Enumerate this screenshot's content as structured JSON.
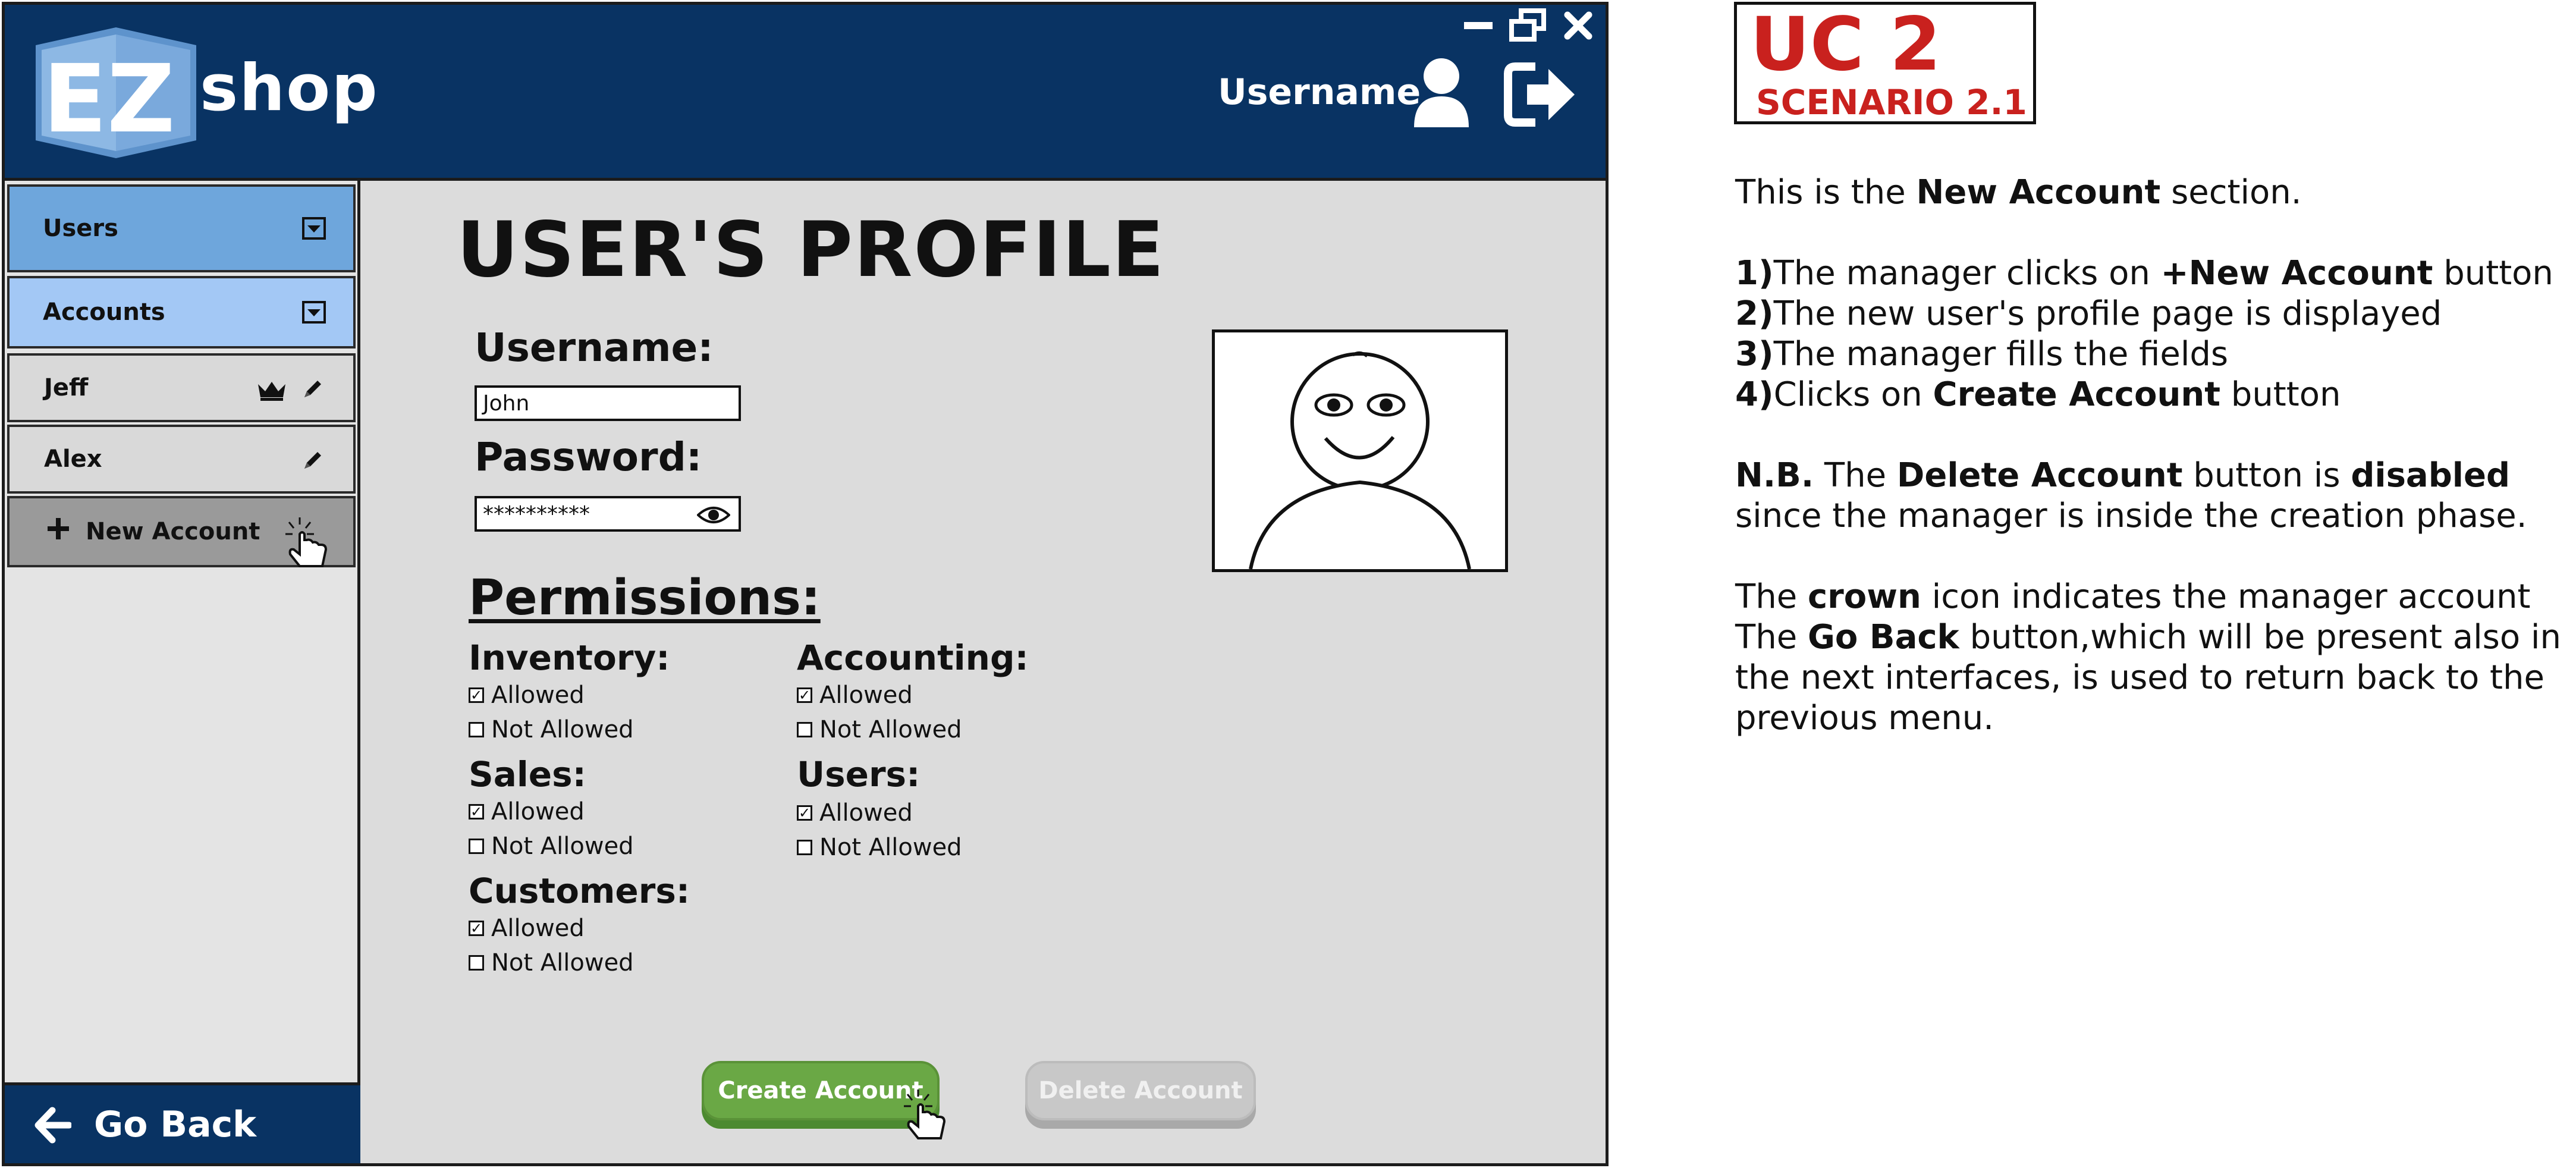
{
  "app": {
    "logo_letters": "EZ",
    "logo_text": "shop",
    "username_label": "Username"
  },
  "sidebar": {
    "users_label": "Users",
    "accounts_label": "Accounts",
    "accounts": [
      {
        "name": "Jeff",
        "is_manager": true
      },
      {
        "name": "Alex",
        "is_manager": false
      }
    ],
    "new_account_label": "New Account",
    "go_back_label": "Go Back"
  },
  "profile": {
    "title": "USER'S PROFILE",
    "username_label": "Username:",
    "username_value": "John",
    "password_label": "Password:",
    "password_value": "**********",
    "permissions_title": "Permissions:",
    "permissions": {
      "inventory": {
        "label": "Inventory:",
        "allowed": "Allowed",
        "not_allowed": "Not Allowed",
        "value": "Allowed"
      },
      "accounting": {
        "label": "Accounting:",
        "allowed": "Allowed",
        "not_allowed": "Not Allowed",
        "value": "Allowed"
      },
      "sales": {
        "label": "Sales:",
        "allowed": "Allowed",
        "not_allowed": "Not Allowed",
        "value": "Allowed"
      },
      "users": {
        "label": "Users:",
        "allowed": "Allowed",
        "not_allowed": "Not Allowed",
        "value": "Allowed"
      },
      "customers": {
        "label": "Customers:",
        "allowed": "Allowed",
        "not_allowed": "Not Allowed",
        "value": "Allowed"
      }
    },
    "create_button": "Create Account",
    "delete_button": "Delete Account"
  },
  "annotation": {
    "uc_title": "UC 2",
    "uc_scenario": "SCENARIO 2.1",
    "intro": [
      "This is the ",
      "New Account",
      " section."
    ],
    "steps": [
      {
        "num": "1)",
        "pre": "The manager clicks on ",
        "bold": "+New Account",
        "post": " button"
      },
      {
        "num": "2)",
        "pre": "The new user's profile page is displayed",
        "bold": "",
        "post": ""
      },
      {
        "num": "3)",
        "pre": "The manager fills the fields",
        "bold": "",
        "post": ""
      },
      {
        "num": "4)",
        "pre": "Clicks on ",
        "bold": "Create Account",
        "post": " button"
      }
    ],
    "nb": {
      "label": "N.B.",
      "t1": " The ",
      "b1": "Delete Account",
      "t2": " button is ",
      "b2": "disabled",
      "t3": " since the manager is inside the creation phase."
    },
    "crown_note": {
      "t1": "The ",
      "b1": "crown",
      "t2": " icon indicates the manager account"
    },
    "goback_note": {
      "t1": "The ",
      "b1": "Go Back",
      "t2": " button,which will be present also in the next interfaces, is used to return back to the previous menu."
    }
  },
  "colors": {
    "topbar": "#093363",
    "users_tab": "#6ea6dc",
    "accounts_tab": "#a3c8f5",
    "create_button": "#6aa845",
    "delete_button_disabled": "#c8c8c8",
    "uc_red": "#c9211e"
  }
}
